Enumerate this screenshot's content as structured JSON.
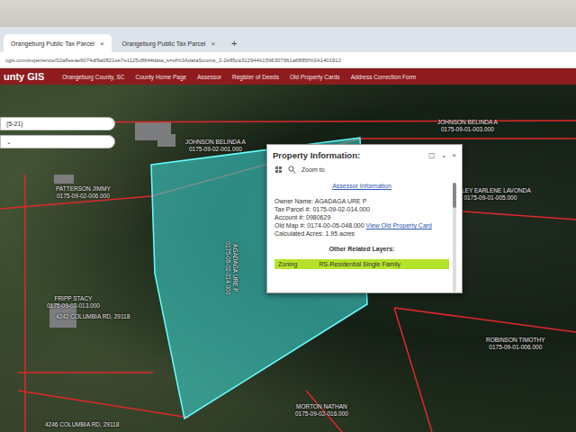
{
  "browser": {
    "tabs": [
      {
        "label": "Orangeburg Public Tax Parcel",
        "close": "×",
        "selected": true
      },
      {
        "label": "Orangeburg Public Tax Parcel",
        "close": "×",
        "selected": false
      }
    ],
    "new_tab": "+",
    "address": "cgis.com/experience/02a8eeae9074df9a0821ee7e1125c864#data_s=id%3AdataSource_2-2e85ca312944b1596307961a6885f%3A1401912"
  },
  "header": {
    "title": "unty GIS",
    "links": [
      "Orangeburg County, SC",
      "County Home Page",
      "Assessor",
      "Register of Deeds",
      "Old Property Cards",
      "Address Correction Form"
    ]
  },
  "map": {
    "search": [
      {
        "text": "(5-21)"
      },
      {
        "text": "⌄"
      }
    ],
    "parcels": [
      {
        "owner": "PATTERSON JIMMY",
        "parcel": "0175-09-02-006.000"
      },
      {
        "owner": "JOHNSON BELINDA A",
        "parcel": "0175-09-02-001.000"
      },
      {
        "owner": "JOHNSON BELINDA A",
        "parcel": "0175-09-01-003.000"
      },
      {
        "owner": "SEALEY EARLENE LAVONDA",
        "parcel": "0175-09-01-005.000"
      },
      {
        "owner": "FRIPP STACY",
        "parcel": "0175-09-02-013.000"
      },
      {
        "owner": "AGADAGA URE P",
        "parcel": "0175-09-02-014.000"
      },
      {
        "owner": "MORTON NATHAN",
        "parcel": "0175-09-02-016.000"
      },
      {
        "owner": "ROBINSON TIMOTHY",
        "parcel": "0175-09-01-006.000"
      }
    ],
    "addresses": [
      "4242 COLUMBIA RD, 29118",
      "4246 COLUMBIA RD, 29118"
    ]
  },
  "popup": {
    "title": "Property Information:",
    "controls": [
      "▢",
      "⌄",
      "×"
    ],
    "zoom": "Zoom to",
    "section": "Assessor Information",
    "fields": [
      {
        "label": "Owner Name:",
        "value": "AGADAGA URE P",
        "link": ""
      },
      {
        "label": "Tax Parcel #:",
        "value": "0175-09-02-014.000",
        "link": ""
      },
      {
        "label": "Account #:",
        "value": "0980629",
        "link": ""
      },
      {
        "label": "Old Map #:",
        "value": "0174-00-05-048.000",
        "link": "View Old Property Card"
      },
      {
        "label": "Calculated Acres:",
        "value": "1.95 acres",
        "link": ""
      }
    ],
    "related_title": "Other Related Layers:",
    "layers": [
      {
        "name": "Zoning",
        "value": "RS-Residential Single Family",
        "selected": true
      }
    ]
  }
}
